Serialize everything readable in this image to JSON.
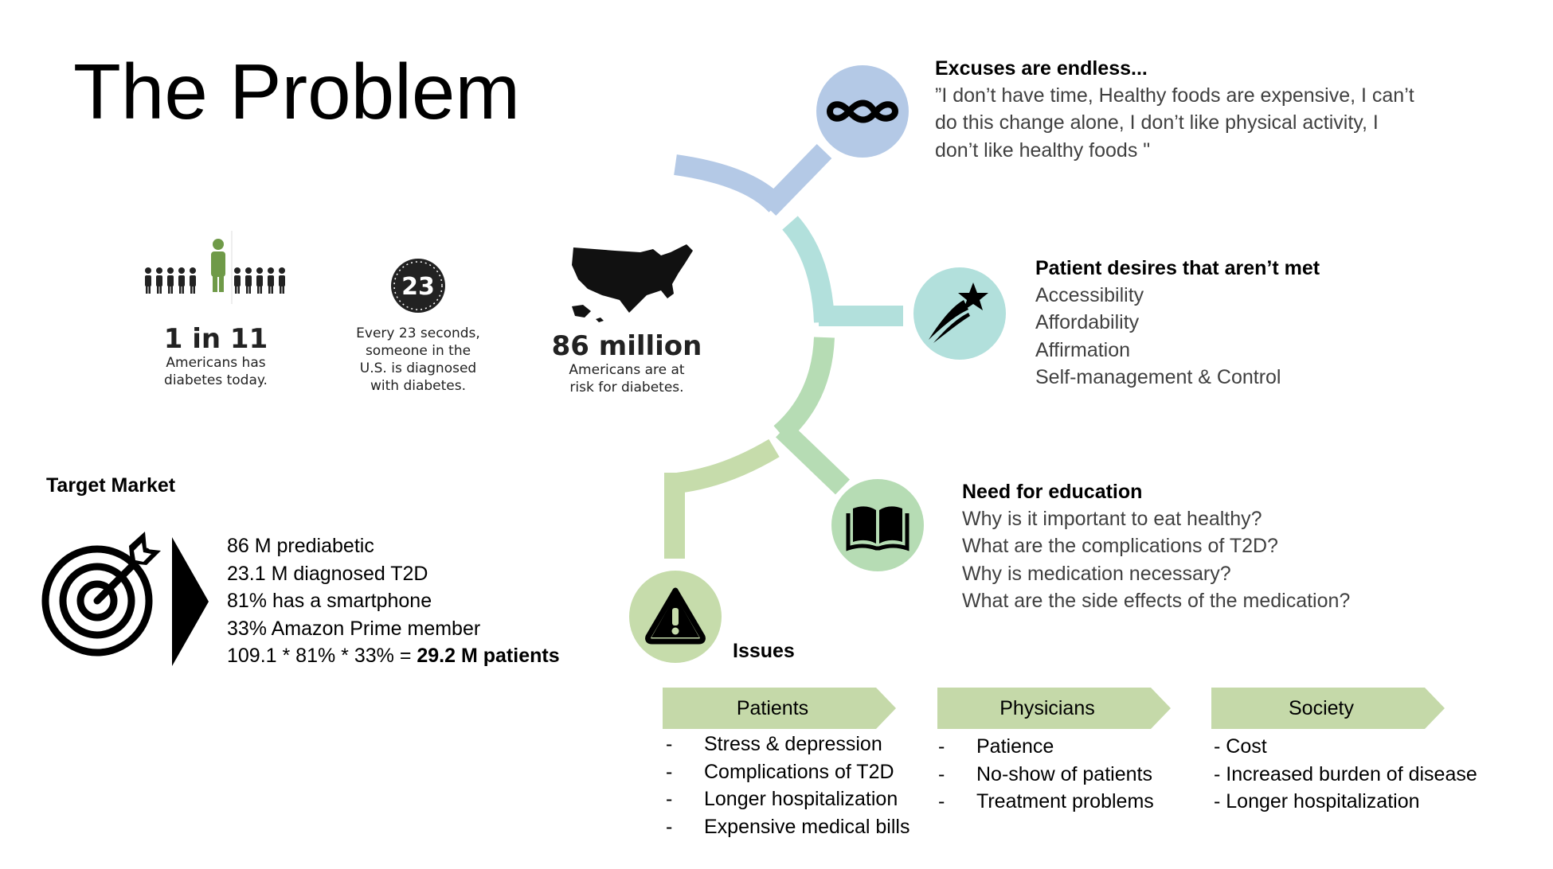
{
  "slide": {
    "title": "The Problem"
  },
  "stats": [
    {
      "big": "1 in 11",
      "small1": "Americans has",
      "small2": "diabetes today."
    },
    {
      "badge": "23",
      "small1": "Every 23 seconds,",
      "small2": "someone in the",
      "small3": "U.S. is diagnosed",
      "small4": "with diabetes."
    },
    {
      "big": "86 million",
      "small1": "Americans are at",
      "small2": "risk for diabetes."
    }
  ],
  "target_market": {
    "heading": "Target Market",
    "lines": [
      "86 M prediabetic",
      "23.1 M diagnosed T2D",
      "81% has a smartphone",
      "33% Amazon Prime member"
    ],
    "formula_prefix": "109.1 * 81% * 33% = ",
    "formula_result": "29.2 M patients"
  },
  "excuses": {
    "heading": "Excuses are endless...",
    "lines": [
      "”I don’t have time, Healthy foods are expensive, I can’t",
      "do this change alone, I don’t like physical activity, I",
      "don’t like healthy foods \""
    ]
  },
  "desires": {
    "heading": "Patient desires that aren’t met",
    "lines": [
      "Accessibility",
      "Affordability",
      "Affirmation",
      "Self-management & Control"
    ]
  },
  "education": {
    "heading": "Need for education",
    "lines": [
      "Why is it important to eat healthy?",
      "What are the complications of T2D?",
      "Why is medication necessary?",
      "What are the side effects of the medication?"
    ]
  },
  "issues": {
    "heading": "Issues",
    "columns": [
      {
        "label": "Patients",
        "dash": "-",
        "items": [
          "Stress & depression",
          "Complications of T2D",
          "Longer hospitalization",
          "Expensive medical bills"
        ]
      },
      {
        "label": "Physicians",
        "dash": "-",
        "items": [
          "Patience",
          "No-show of patients",
          "Treatment problems"
        ]
      },
      {
        "label": "Society",
        "items": [
          "- Cost",
          "- Increased burden of disease",
          "- Longer hospitalization"
        ]
      }
    ]
  },
  "colors": {
    "blue": "#b4c9e6",
    "teal": "#b2e0dc",
    "green": "#b6dcb4",
    "olive": "#c6dcab",
    "tab": "#c5d9a9"
  },
  "icons": [
    "infinity-icon",
    "shooting-star-icon",
    "open-book-icon",
    "warning-icon",
    "target-arrow-icon",
    "people-icon",
    "clock-icon",
    "usa-map-icon"
  ]
}
